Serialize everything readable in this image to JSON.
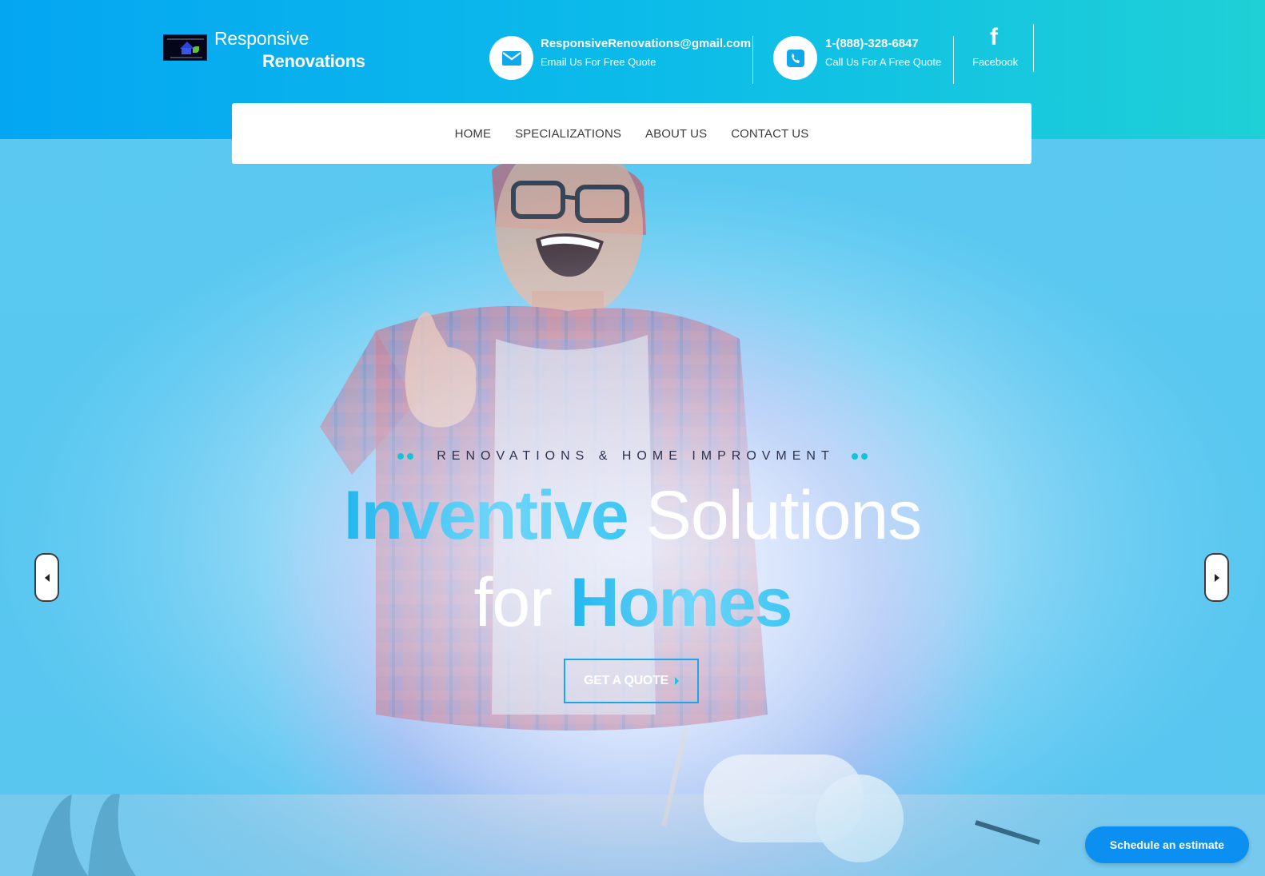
{
  "brand": {
    "name_line1": "Responsive",
    "name_line2": "Renovations"
  },
  "contacts": {
    "email": {
      "icon": "envelope-icon",
      "title": "ResponsiveRenovations@gmail.com",
      "subtitle": "Email Us For Free Quote"
    },
    "phone": {
      "icon": "phone-icon",
      "title": "1-(888)-328-6847",
      "subtitle": "Call Us For A Free Quote"
    },
    "social": {
      "icon": "facebook-icon",
      "label": "Facebook",
      "glyph": "f"
    }
  },
  "nav": {
    "items": [
      "HOME",
      "SPECIALIZATIONS",
      "ABOUT US",
      "CONTACT US"
    ]
  },
  "hero": {
    "tagline": "RENOVATIONS & HOME IMPROVMENT",
    "headline_word1": "Inventive",
    "headline_word2": "Solutions",
    "headline_word3": "for",
    "headline_word4": "Homes",
    "cta_label": "GET A QUOTE",
    "prev_icon": "chevron-left-icon",
    "next_icon": "chevron-right-icon"
  },
  "floating": {
    "estimate_label": "Schedule an estimate"
  },
  "colors": {
    "header_start": "#04a6f2",
    "header_end": "#1fd0d6",
    "accent_teal": "#14c3d6",
    "cta_border": "#1aa6e8",
    "estimate_button": "#0b8ff0"
  }
}
